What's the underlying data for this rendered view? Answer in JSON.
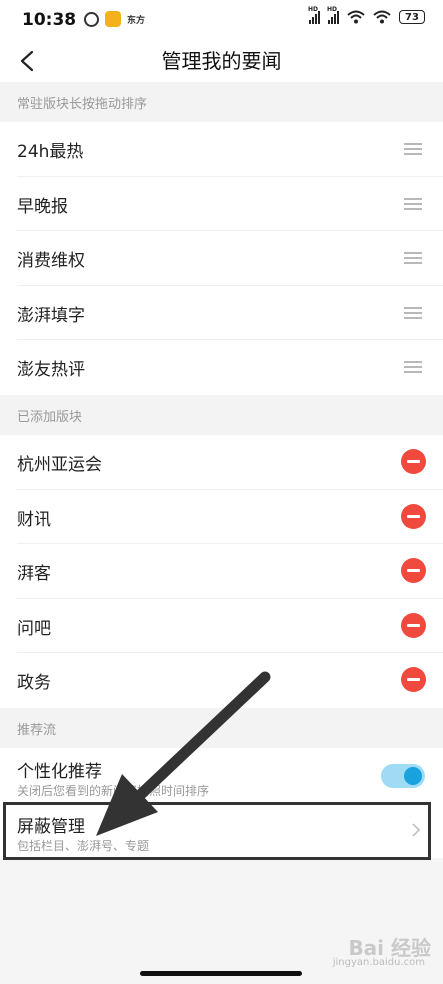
{
  "status": {
    "time": "10:38",
    "app_mini": "东方",
    "hd1": "HD",
    "hd2": "HD",
    "battery": "73"
  },
  "header": {
    "title": "管理我的要闻"
  },
  "sections": {
    "pinned": "常驻版块长按拖动排序",
    "added": "已添加版块",
    "recommend": "推荐流"
  },
  "pinned_items": [
    "24h最热",
    "早晚报",
    "消费维权",
    "澎湃填字",
    "澎友热评"
  ],
  "added_items": [
    "杭州亚运会",
    "财讯",
    "湃客",
    "问吧",
    "政务"
  ],
  "personalized": {
    "label": "个性化推荐",
    "description": "关闭后您看到的新闻将按照时间排序",
    "enabled": true
  },
  "block_mgmt": {
    "label": "屏蔽管理",
    "description": "包括栏目、澎湃号、专题"
  },
  "watermark": {
    "text": "Bai 经验",
    "url": "jingyan.baidu.com"
  },
  "colors": {
    "remove": "#f04a3e",
    "toggle_on": "#1aa1e0",
    "toggle_track": "#9fdcf3"
  },
  "icons": [
    "back-arrow-icon",
    "drag-handle-icon",
    "remove-icon",
    "chevron-right-icon",
    "alarm-icon",
    "note-icon",
    "signal-icon",
    "wifi-icon",
    "battery-icon"
  ]
}
